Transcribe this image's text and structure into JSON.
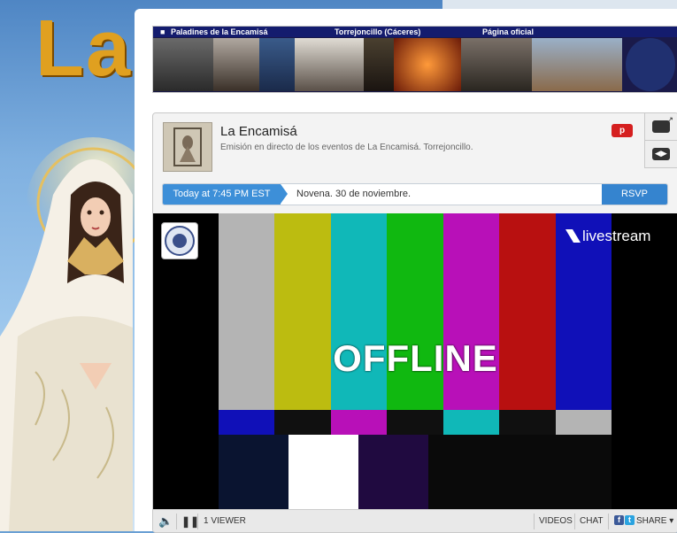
{
  "background": {
    "title": "La I"
  },
  "banner": {
    "left": "Paladines de la Encamisá",
    "center": "Torrejoncillo (Cáceres)",
    "right": "Página oficial"
  },
  "channel": {
    "title": "La Encamisá",
    "description": "Emisión en directo de los eventos de La Encamisá. Torrejoncillo.",
    "yt_badge": "p"
  },
  "event": {
    "time": "Today at 7:45 PM EST",
    "title": "Novena. 30 de noviembre.",
    "rsvp": "RSVP"
  },
  "player": {
    "status": "OFFLINE",
    "brand": "livestream"
  },
  "controls": {
    "viewers": "1 VIEWER",
    "videos": "VIDEOS",
    "chat": "CHAT",
    "share": "SHARE",
    "share_arrow": "▾"
  },
  "colors": {
    "test_bars": [
      "#b4b4b4",
      "#bcbc10",
      "#10b8b8",
      "#10b810",
      "#b810b8",
      "#b81010",
      "#1010b8"
    ],
    "test_bars_mid": [
      "#1010b8",
      "#101010",
      "#b810b8",
      "#101010",
      "#10b8b8",
      "#101010",
      "#b4b4b4"
    ],
    "accent": "#3d8fd8"
  }
}
